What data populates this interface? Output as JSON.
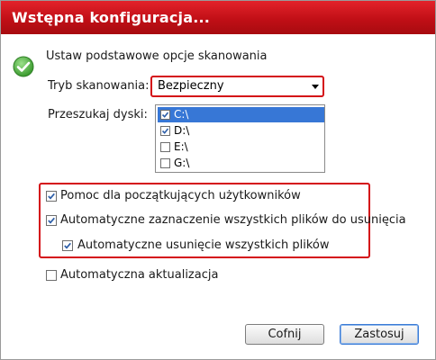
{
  "dialog": {
    "title": "Wstępna konfiguracja..."
  },
  "heading": "Ustaw podstawowe opcje skanowania",
  "scan_mode": {
    "label": "Tryb skanowania:",
    "value": "Bezpieczny"
  },
  "drives": {
    "label": "Przeszukaj dyski:",
    "items": [
      {
        "label": "C:\\",
        "checked": true,
        "selected": true
      },
      {
        "label": "D:\\",
        "checked": true,
        "selected": false
      },
      {
        "label": "E:\\",
        "checked": false,
        "selected": false
      },
      {
        "label": "G:\\",
        "checked": false,
        "selected": false
      }
    ]
  },
  "options": {
    "beginner_help": {
      "label": "Pomoc dla początkujących użytkowników",
      "checked": true
    },
    "auto_select": {
      "label": "Automatyczne zaznaczenie wszystkich plików do usunięcia",
      "checked": true
    },
    "auto_delete": {
      "label": "Automatyczne usunięcie wszystkich plików",
      "checked": true
    },
    "auto_update": {
      "label": "Automatyczna aktualizacja",
      "checked": false
    }
  },
  "buttons": {
    "back": "Cofnij",
    "apply": "Zastosuj"
  },
  "colors": {
    "titlebar": "#c8141b",
    "highlight_border": "#d40f16",
    "selection": "#3777d6"
  },
  "icons": {
    "status": "check-circle-icon",
    "dropdown": "chevron-down-icon"
  }
}
